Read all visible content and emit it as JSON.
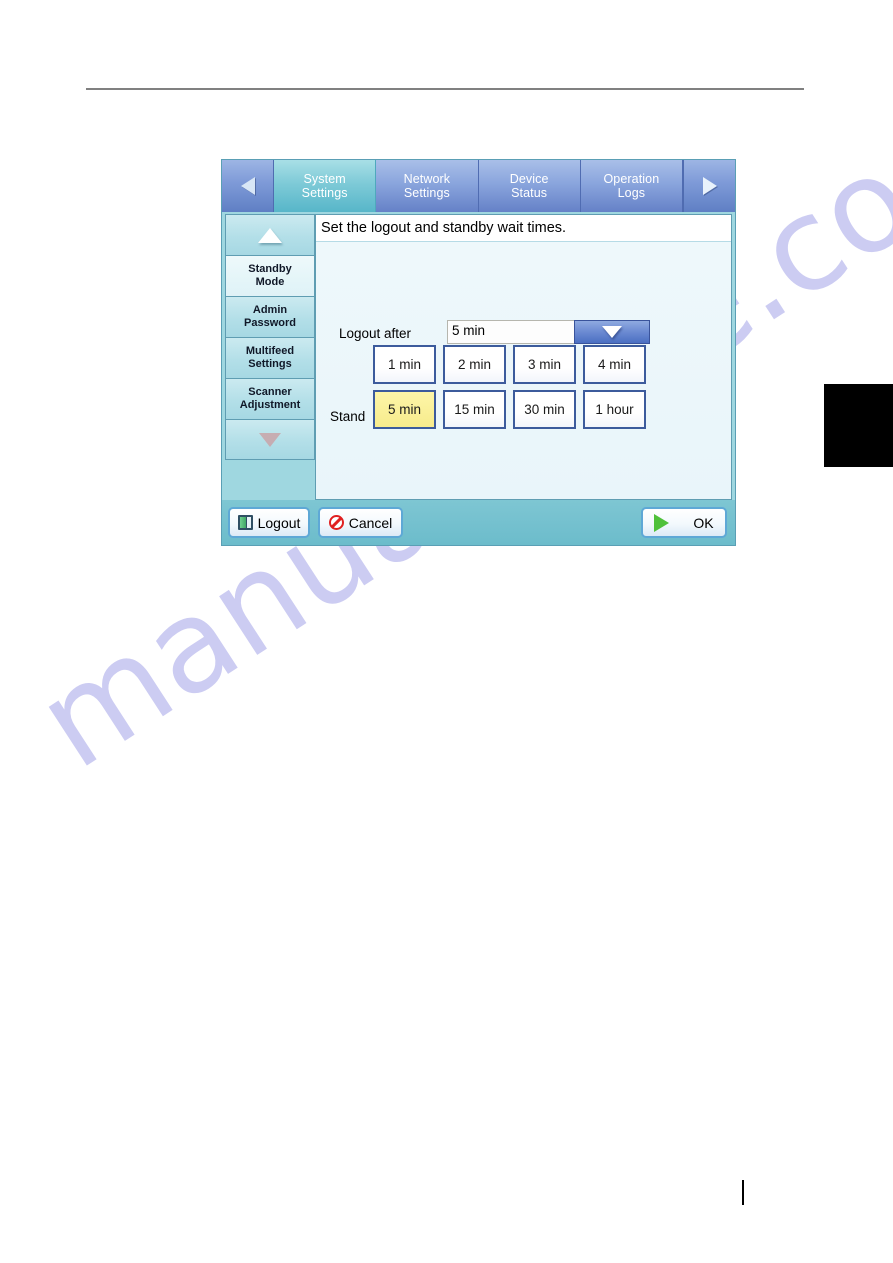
{
  "page": {
    "watermark": "manualshive.com"
  },
  "panel": {
    "tabs": {
      "prev_icon": "triangle-left-icon",
      "next_icon": "triangle-right-icon",
      "items": [
        {
          "line1": "System",
          "line2": "Settings",
          "active": true
        },
        {
          "line1": "Network",
          "line2": "Settings",
          "active": false
        },
        {
          "line1": "Device",
          "line2": "Status",
          "active": false
        },
        {
          "line1": "Operation",
          "line2": "Logs",
          "active": false
        }
      ]
    },
    "sidebar": {
      "scroll_up_icon": "triangle-up-icon",
      "scroll_down_icon": "triangle-down-icon",
      "items": [
        {
          "line1": "Standby",
          "line2": "Mode",
          "selected": true
        },
        {
          "line1": "Admin",
          "line2": "Password",
          "selected": false
        },
        {
          "line1": "Multifeed",
          "line2": "Settings",
          "selected": false
        },
        {
          "line1": "Scanner",
          "line2": "Adjustment",
          "selected": false
        }
      ]
    },
    "content": {
      "title": "Set the logout and standby wait times.",
      "logout_label": "Logout after",
      "standby_label": "Stand",
      "combo": {
        "value": "5 min",
        "arrow_icon": "chevron-down-icon"
      },
      "dropdown": {
        "options": [
          {
            "label": "1 min",
            "selected": false
          },
          {
            "label": "2 min",
            "selected": false
          },
          {
            "label": "3 min",
            "selected": false
          },
          {
            "label": "4 min",
            "selected": false
          },
          {
            "label": "5 min",
            "selected": true
          },
          {
            "label": "15 min",
            "selected": false
          },
          {
            "label": "30 min",
            "selected": false
          },
          {
            "label": "1 hour",
            "selected": false
          }
        ]
      }
    },
    "footer": {
      "logout_label": "Logout",
      "logout_icon": "door-exit-icon",
      "cancel_label": "Cancel",
      "cancel_icon": "prohibition-icon",
      "ok_label": "OK",
      "ok_icon": "play-triangle-icon"
    }
  },
  "colors": {
    "active_tab": "#7ecad7",
    "inactive_tab": "#8aa5dd",
    "selection_yellow": "#f7eb8c",
    "panel_teal": "#7fc8d4",
    "ok_green": "#4fc13a",
    "cancel_red": "#e02020"
  }
}
